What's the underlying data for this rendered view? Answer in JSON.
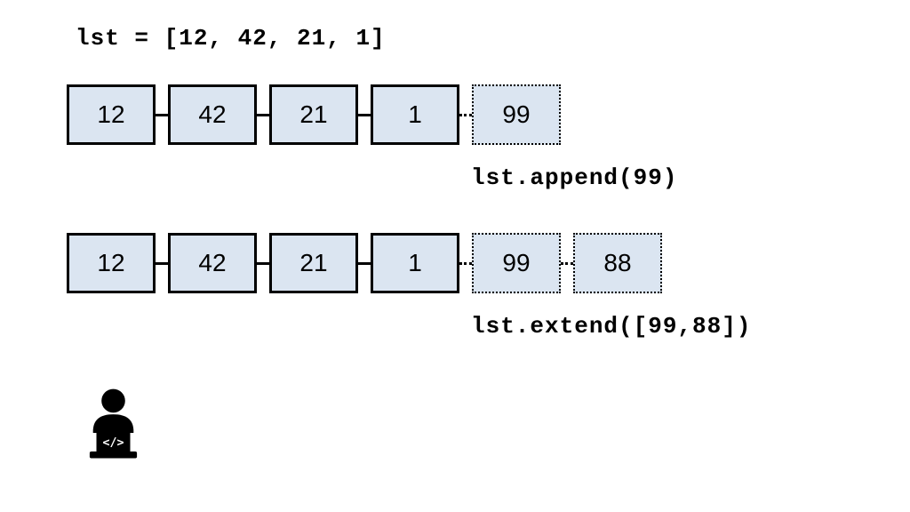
{
  "code": "lst = [12, 42, 21, 1]",
  "row1": {
    "solid": [
      "12",
      "42",
      "21",
      "1"
    ],
    "dashed": [
      "99"
    ],
    "label": "lst.append(99)"
  },
  "row2": {
    "solid": [
      "12",
      "42",
      "21",
      "1"
    ],
    "dashed": [
      "99",
      "88"
    ],
    "label": "lst.extend([99,88])"
  }
}
